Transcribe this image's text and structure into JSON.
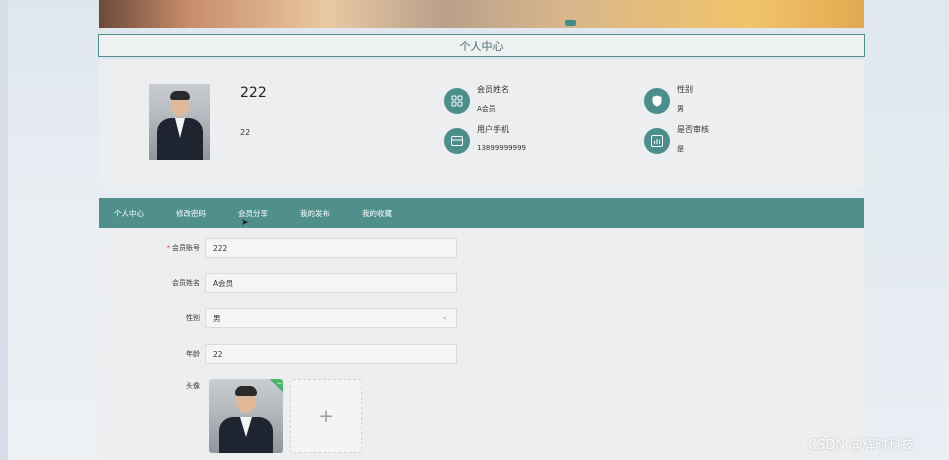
{
  "page": {
    "title": "个人中心"
  },
  "profile": {
    "account": "222",
    "age": "22",
    "fields": [
      {
        "label": "会员姓名",
        "value": "A会员",
        "icon": "grid-icon"
      },
      {
        "label": "性别",
        "value": "男",
        "icon": "shield-icon"
      },
      {
        "label": "用户手机",
        "value": "13899999999",
        "icon": "card-icon"
      },
      {
        "label": "是否审核",
        "value": "是",
        "icon": "chart-icon"
      }
    ]
  },
  "nav": {
    "items": [
      "个人中心",
      "修改密码",
      "会员分享",
      "我的发布",
      "我的收藏"
    ]
  },
  "form": {
    "account": {
      "label": "会员账号",
      "value": "222"
    },
    "name": {
      "label": "会员姓名",
      "value": "A会员"
    },
    "gender": {
      "label": "性别",
      "value": "男"
    },
    "age": {
      "label": "年龄",
      "value": "22"
    },
    "avatar": {
      "label": "头像",
      "add_symbol": "+"
    }
  },
  "watermark": "CSDN @辉时科技",
  "colors": {
    "accent": "#4f8f8c",
    "success": "#4cb56c",
    "required": "#e05050"
  }
}
